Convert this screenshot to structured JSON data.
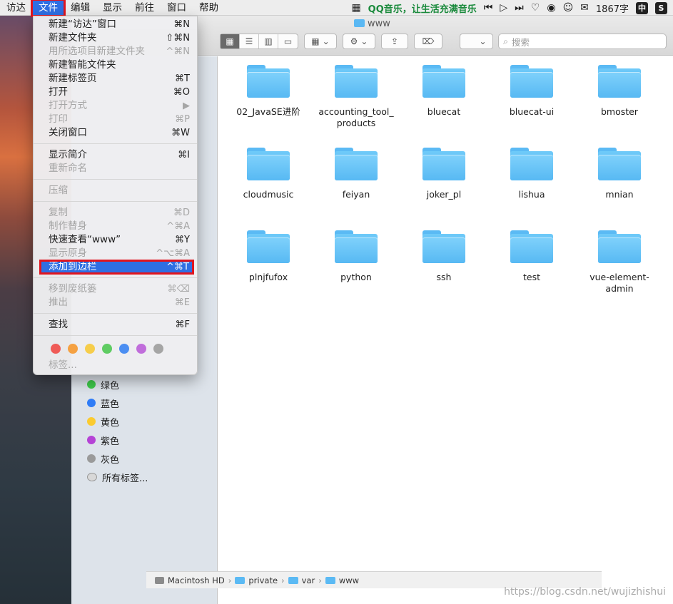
{
  "menubar": {
    "items": [
      "访达",
      "文件",
      "编辑",
      "显示",
      "前往",
      "窗口",
      "帮助"
    ],
    "qq_text": "QQ音乐，让生活充满音乐",
    "word_count": "1867字",
    "input_method": "中",
    "sogou": "S"
  },
  "menu": {
    "items": [
      {
        "label": "新建“访达”窗口",
        "shortcut": "⌘N"
      },
      {
        "label": "新建文件夹",
        "shortcut": "⇧⌘N"
      },
      {
        "label": "用所选项目新建文件夹",
        "shortcut": "^⌘N"
      },
      {
        "label": "新建智能文件夹",
        "shortcut": ""
      },
      {
        "label": "新建标签页",
        "shortcut": "⌘T"
      },
      {
        "label": "打开",
        "shortcut": "⌘O"
      },
      {
        "label": "打开方式",
        "shortcut": "▶"
      },
      {
        "label": "打印",
        "shortcut": "⌘P"
      },
      {
        "label": "关闭窗口",
        "shortcut": "⌘W"
      },
      {
        "label": "显示简介",
        "shortcut": "⌘I"
      },
      {
        "label": "重新命名",
        "shortcut": ""
      },
      {
        "label": "压缩",
        "shortcut": ""
      },
      {
        "label": "复制",
        "shortcut": "⌘D"
      },
      {
        "label": "制作替身",
        "shortcut": "^⌘A"
      },
      {
        "label": "快速查看“www”",
        "shortcut": "⌘Y"
      },
      {
        "label": "显示原身",
        "shortcut": "^⌥⌘A"
      },
      {
        "label": "添加到边栏",
        "shortcut": "^⌘T"
      },
      {
        "label": "移到废纸篓",
        "shortcut": "⌘⌫"
      },
      {
        "label": "推出",
        "shortcut": "⌘E"
      },
      {
        "label": "查找",
        "shortcut": "⌘F"
      },
      {
        "label": "标签...",
        "shortcut": ""
      }
    ],
    "tag_colors": [
      "#ef5b57",
      "#f5a142",
      "#f6cd4b",
      "#5fcc63",
      "#4b8ef2",
      "#c06ddb",
      "#a5a5a5"
    ]
  },
  "window": {
    "title": "www",
    "search_placeholder": "搜索"
  },
  "sidebar": {
    "tags": [
      {
        "label": "绿色",
        "color": "#3ec94a"
      },
      {
        "label": "蓝色",
        "color": "#2f7cf6"
      },
      {
        "label": "黄色",
        "color": "#fbcb2f"
      },
      {
        "label": "紫色",
        "color": "#b543d6"
      },
      {
        "label": "灰色",
        "color": "#9a9a9a"
      },
      {
        "label": "所有标签...",
        "color": ""
      }
    ]
  },
  "files": [
    "02_JavaSE进阶",
    "accounting_tool_ products",
    "bluecat",
    "bluecat-ui",
    "bmoster",
    "cloudmusic",
    "feiyan",
    "joker_pl",
    "lishua",
    "mnian",
    "plnjfufox",
    "python",
    "ssh",
    "test",
    "vue-element- admin"
  ],
  "pathbar": [
    "Macintosh HD",
    "private",
    "var",
    "www"
  ],
  "watermark": "https://blog.csdn.net/wujizhishui"
}
